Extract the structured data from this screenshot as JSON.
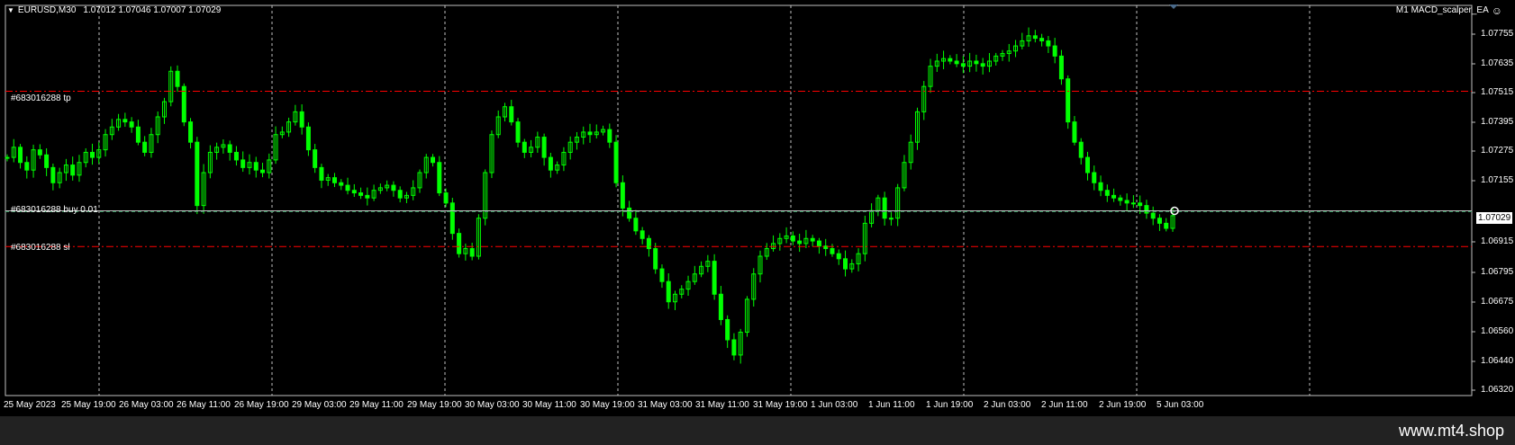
{
  "header": {
    "symbol": "EURUSD,M30",
    "ohlc": "1.07012 1.07046 1.07007 1.07029",
    "ea_name": "M1 MACD_scalper_EA"
  },
  "orders": {
    "tp_label": "#683016288 tp",
    "buy_label": "#683016288 buy 0.01",
    "sl_label": "#683016288 sl"
  },
  "current_price": "1.07029",
  "price_axis": [
    "1.07755",
    "1.07635",
    "1.07515",
    "1.07395",
    "1.07275",
    "1.07155",
    "1.07029",
    "1.06915",
    "1.06795",
    "1.06675",
    "1.06560",
    "1.06440",
    "1.06320"
  ],
  "time_axis": [
    "25 May 2023",
    "25 May 19:00",
    "26 May 03:00",
    "26 May 11:00",
    "26 May 19:00",
    "29 May 03:00",
    "29 May 11:00",
    "29 May 19:00",
    "30 May 03:00",
    "30 May 11:00",
    "30 May 19:00",
    "31 May 03:00",
    "31 May 11:00",
    "31 May 19:00",
    "1 Jun 03:00",
    "1 Jun 11:00",
    "1 Jun 19:00",
    "2 Jun 03:00",
    "2 Jun 11:00",
    "2 Jun 19:00",
    "5 Jun 03:00"
  ],
  "watermark": "www.mt4.shop",
  "colors": {
    "candle": "#00ff00",
    "order_tp_sl": "#ff0000",
    "order_entry": "#c0c0c0",
    "grid": "#c0c0c0",
    "background": "#000000"
  },
  "chart_data": {
    "type": "line",
    "series": [
      {
        "name": "EURUSD,M30",
        "y": [
          1.0724,
          1.0728,
          1.0722,
          1.0719,
          1.0727,
          1.0725,
          1.072,
          1.0714,
          1.0718,
          1.0721,
          1.0717,
          1.0722,
          1.0726,
          1.0724,
          1.0727,
          1.0733,
          1.0736,
          1.0739,
          1.0738,
          1.0736,
          1.073,
          1.0726,
          1.0733,
          1.074,
          1.0746,
          1.0758,
          1.0752,
          1.0738,
          1.073,
          1.0705,
          1.0718,
          1.0726,
          1.0728,
          1.0729,
          1.0726,
          1.0723,
          1.072,
          1.0722,
          1.0719,
          1.0718,
          1.0723,
          1.0733,
          1.0734,
          1.0738,
          1.0742,
          1.0736,
          1.0727,
          1.072,
          1.0715,
          1.0716,
          1.0714,
          1.0713,
          1.0711,
          1.071,
          1.0709,
          1.0708,
          1.0711,
          1.0712,
          1.0713,
          1.0711,
          1.0708,
          1.0709,
          1.0712,
          1.0718,
          1.0724,
          1.0722,
          1.071,
          1.0706,
          1.0694,
          1.0686,
          1.0688,
          1.0685,
          1.07,
          1.0718,
          1.0733,
          1.074,
          1.0744,
          1.0738,
          1.073,
          1.0726,
          1.0728,
          1.0732,
          1.0724,
          1.0719,
          1.0721,
          1.0726,
          1.073,
          1.0732,
          1.0734,
          1.0733,
          1.0734,
          1.0735,
          1.073,
          1.0714,
          1.0704,
          1.07,
          1.0695,
          1.0692,
          1.0688,
          1.068,
          1.0675,
          1.0667,
          1.067,
          1.0672,
          1.0675,
          1.0678,
          1.0681,
          1.0683,
          1.067,
          1.066,
          1.0652,
          1.0646,
          1.0655,
          1.0668,
          1.0678,
          1.0685,
          1.0688,
          1.069,
          1.0692,
          1.0693,
          1.0691,
          1.069,
          1.0692,
          1.0691,
          1.0689,
          1.0688,
          1.0686,
          1.0684,
          1.068,
          1.0682,
          1.0686,
          1.0698,
          1.0703,
          1.0708,
          1.07,
          1.07,
          1.0712,
          1.0722,
          1.073,
          1.0742,
          1.0752,
          1.076,
          1.0762,
          1.0763,
          1.0762,
          1.0761,
          1.076,
          1.0762,
          1.0761,
          1.076,
          1.0762,
          1.0764,
          1.0765,
          1.0766,
          1.0768,
          1.077,
          1.0772,
          1.0771,
          1.077,
          1.0768,
          1.0764,
          1.0755,
          1.0738,
          1.073,
          1.0724,
          1.0718,
          1.0714,
          1.0711,
          1.0709,
          1.0708,
          1.0707,
          1.0706,
          1.0706,
          1.0705,
          1.0702,
          1.07,
          1.0698,
          1.0696,
          1.0701
        ]
      }
    ],
    "ylim": [
      1.063,
      1.0784
    ],
    "grid": true,
    "levels": {
      "tp": 1.07501,
      "entry": 1.07029,
      "sl": 1.06888
    }
  }
}
